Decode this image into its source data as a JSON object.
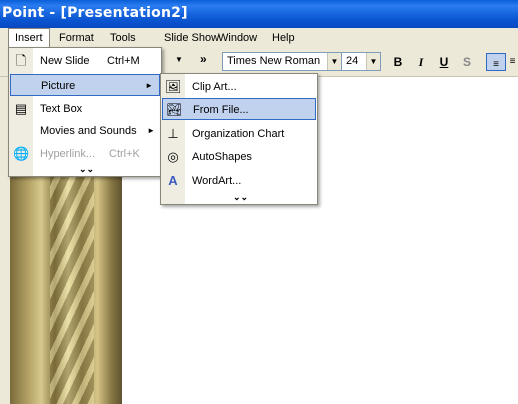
{
  "window": {
    "title": "Point - [Presentation2]"
  },
  "menubar": {
    "items": [
      {
        "label": "Insert"
      },
      {
        "label": "Format"
      },
      {
        "label": "Tools"
      },
      {
        "label": "Slide Show"
      },
      {
        "label": "Window"
      },
      {
        "label": "Help"
      }
    ]
  },
  "toolbar": {
    "overflow": "»",
    "font": "Times New Roman",
    "size": "24",
    "bold": "B",
    "italic": "I",
    "underline": "U",
    "shadow": "S"
  },
  "insert_menu": {
    "items": [
      {
        "label": "New Slide",
        "shortcut": "Ctrl+M",
        "icon": "new-slide-icon"
      },
      {
        "label": "Picture",
        "submenu": "►",
        "highlighted": true
      },
      {
        "label": "Text Box",
        "icon": "text-box-icon"
      },
      {
        "label": "Movies and Sounds",
        "submenu": "►"
      },
      {
        "label": "Hyperlink...",
        "shortcut": "Ctrl+K",
        "disabled": true,
        "icon": "hyperlink-icon"
      }
    ],
    "expand": "⌄⌄"
  },
  "picture_submenu": {
    "items": [
      {
        "label": "Clip Art...",
        "icon": "clip-art-icon"
      },
      {
        "label": "From File...",
        "icon": "from-file-icon",
        "highlighted": true
      },
      {
        "label": "Organization Chart",
        "icon": "org-chart-icon"
      },
      {
        "label": "AutoShapes",
        "icon": "autoshapes-icon"
      },
      {
        "label": "WordArt...",
        "icon": "wordart-icon"
      }
    ],
    "expand": "⌄⌄"
  },
  "colors": {
    "titlebar": "#0a5fd8",
    "highlight": "#c1d2ee",
    "highlight_border": "#316ac5",
    "menubar": "#ece9d8"
  }
}
